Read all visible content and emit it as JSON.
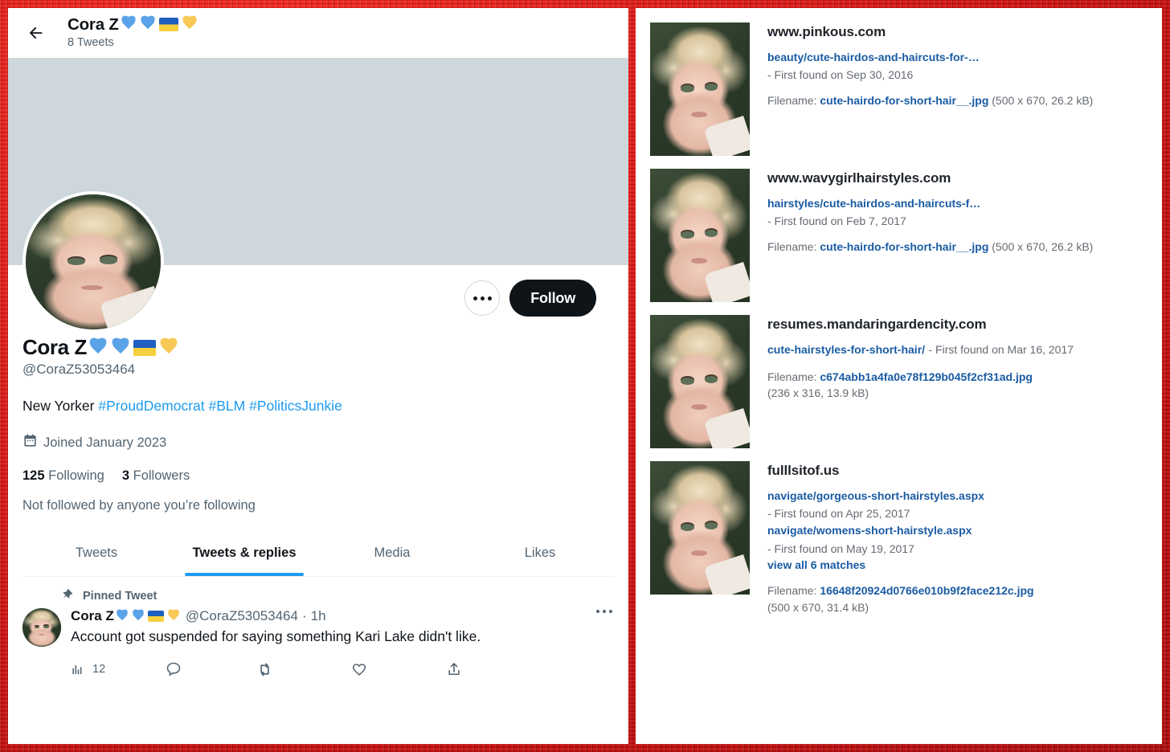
{
  "profile": {
    "back_icon": "back-arrow-icon",
    "header_name": "Cora Z",
    "header_tweets": "8 Tweets",
    "display_name": "Cora Z",
    "handle": "@CoraZ53053464",
    "bio_plain": "New Yorker ",
    "bio_hashtags": [
      "#ProudDemocrat",
      "#BLM",
      "#PoliticsJunkie"
    ],
    "joined": "Joined January 2023",
    "joined_icon": "calendar-icon",
    "following_count": "125",
    "following_label": "Following",
    "followers_count": "3",
    "followers_label": "Followers",
    "not_followed": "Not followed by anyone you’re following",
    "more_options_label": "More",
    "follow_label": "Follow",
    "banner_color": "#cdd7dc",
    "accent_color": "#1d9bf0",
    "emoji_names": [
      "blue-heart-emoji",
      "blue-heart-emoji",
      "ukraine-flag-emoji",
      "yellow-heart-emoji"
    ],
    "tabs": [
      {
        "label": "Tweets",
        "active": false
      },
      {
        "label": "Tweets & replies",
        "active": true
      },
      {
        "label": "Media",
        "active": false
      },
      {
        "label": "Likes",
        "active": false
      }
    ]
  },
  "tweet": {
    "pinned_label": "Pinned Tweet",
    "pin_icon": "pin-icon",
    "author": "Cora Z",
    "handle": "@CoraZ53053464",
    "separator": "·",
    "timestamp": "1h",
    "text": "Account got suspended for saying something Kari Lake didn't like.",
    "more_icon": "more-horizontal-icon",
    "actions": [
      {
        "icon": "analytics-icon",
        "count": "12"
      },
      {
        "icon": "reply-icon",
        "count": ""
      },
      {
        "icon": "retweet-icon",
        "count": ""
      },
      {
        "icon": "like-icon",
        "count": ""
      },
      {
        "icon": "share-icon",
        "count": ""
      }
    ]
  },
  "results": [
    {
      "domain": "www.pinkous.com",
      "paths": [
        {
          "path": "beauty/cute-hairdos-and-haircuts-for-…",
          "found": "- First found on Sep 30, 2016",
          "inline": false
        }
      ],
      "view_all": "",
      "filename_label": "Filename:",
      "filename": "cute-hairdo-for-short-hair__.jpg",
      "dims": "(500 x 670, 26.2 kB)",
      "dims_newline": false
    },
    {
      "domain": "www.wavygirlhairstyles.com",
      "paths": [
        {
          "path": "hairstyles/cute-hairdos-and-haircuts-f…",
          "found": "- First found on Feb 7, 2017",
          "inline": false
        }
      ],
      "view_all": "",
      "filename_label": "Filename:",
      "filename": "cute-hairdo-for-short-hair__.jpg",
      "dims": "(500 x 670, 26.2 kB)",
      "dims_newline": false
    },
    {
      "domain": "resumes.mandaringardencity.com",
      "paths": [
        {
          "path": "cute-hairstyles-for-short-hair/",
          "found": "- First found on Mar 16, 2017",
          "inline": true
        }
      ],
      "view_all": "",
      "filename_label": "Filename:",
      "filename": "c674abb1a4fa0e78f129b045f2cf31ad.jpg",
      "dims": "(236 x 316, 13.9 kB)",
      "dims_newline": true
    },
    {
      "domain": "fulllsitof.us",
      "paths": [
        {
          "path": "navigate/gorgeous-short-hairstyles.aspx",
          "found": "- First found on Apr 25, 2017",
          "inline": false
        },
        {
          "path": "navigate/womens-short-hairstyle.aspx",
          "found": "- First found on May 19, 2017",
          "inline": false
        }
      ],
      "view_all": "view all 6 matches",
      "filename_label": "Filename:",
      "filename": "16648f20924d0766e010b9f2face212c.jpg",
      "dims": "(500 x 670, 31.4 kB)",
      "dims_newline": true
    }
  ]
}
